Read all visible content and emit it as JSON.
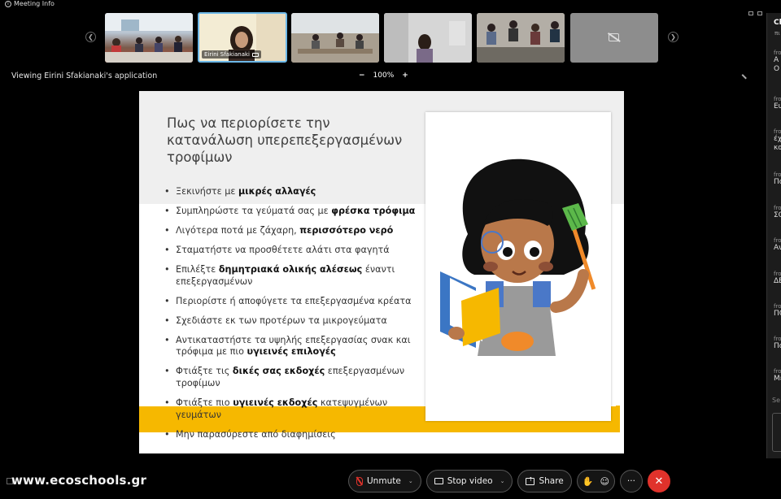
{
  "topbar": {
    "meeting_info": "Meeting Info"
  },
  "participants": [
    {
      "name": "",
      "active": false,
      "video": true
    },
    {
      "name": "Eirini Sfakianaki",
      "active": true,
      "video": true
    },
    {
      "name": "",
      "active": false,
      "video": true
    },
    {
      "name": "",
      "active": false,
      "video": true
    },
    {
      "name": "",
      "active": false,
      "video": true
    },
    {
      "name": "",
      "active": false,
      "video": false,
      "icon": "video-off-icon"
    }
  ],
  "viewbar": {
    "viewing": "Viewing Eirini Sfakianaki's application",
    "zoom_out": "−",
    "zoom_level": "100%",
    "zoom_in": "+"
  },
  "slide": {
    "title": "Πως να περιορίσετε την κατανάλωση υπερεπεξεργασμένων τροφίμων",
    "bullets": [
      {
        "text": "Ξεκινήστε με ",
        "bold": "μικρές αλλαγές",
        "rest": ""
      },
      {
        "text": "Συμπληρώστε τα γεύματά σας με ",
        "bold": "φρέσκα τρόφιμα",
        "rest": ""
      },
      {
        "text": "Λιγότερα ποτά με ζάχαρη, ",
        "bold": "περισσότερο νερό",
        "rest": ""
      },
      {
        "text": "Σταματήστε να προσθέτετε αλάτι στα φαγητά",
        "bold": "",
        "rest": ""
      },
      {
        "text": "Επιλέξτε ",
        "bold": "δημητριακά ολικής αλέσεως",
        "rest": " έναντι επεξεργασμένων"
      },
      {
        "text": "Περιορίστε ή αποφύγετε τα επεξεργασμένα κρέατα",
        "bold": "",
        "rest": ""
      },
      {
        "text": "Σχεδιάστε εκ των προτέρων τα μικρογεύματα",
        "bold": "",
        "rest": ""
      },
      {
        "text": "Αντικαταστήστε τα υψηλής επεξεργασίας σνακ και τρόφιμα με πιο ",
        "bold": "υγιεινές επιλογές",
        "rest": ""
      },
      {
        "text": "Φτιάξτε τις ",
        "bold": "δικές σας εκδοχές",
        "rest": " επεξεργασμένων τροφίμων"
      },
      {
        "text": "Φτιάξτε πιο ",
        "bold": "υγιεινές εκδοχές",
        "rest": " κατεψυγμένων γευμάτων"
      },
      {
        "text": "Μην παρασύρεστε από διαφημίσεις",
        "bold": "",
        "rest": ""
      }
    ],
    "colors": {
      "accent_yellow": "#f6b800",
      "band_gray": "#efefef"
    }
  },
  "logo": "www.ecoschools.gr",
  "controls": {
    "unmute": "Unmute",
    "stop_video": "Stop video",
    "share": "Share",
    "more": "···",
    "end": "✕"
  },
  "chat": {
    "title": "Ch",
    "subtitle": "πι",
    "messages": [
      {
        "from": "fro",
        "text": "Α",
        "text2": "Ο"
      },
      {
        "from": "fro",
        "text": "Ευ",
        "text2": ""
      },
      {
        "from": "fro",
        "text": "έχ",
        "text2": "κα"
      },
      {
        "from": "fro",
        "text": "Πο",
        "text2": ""
      },
      {
        "from": "fro",
        "text": "ΣΟ",
        "text2": ""
      },
      {
        "from": "fro",
        "text": "Αν",
        "text2": ""
      },
      {
        "from": "fro",
        "text": "ΔΕ",
        "text2": ""
      },
      {
        "from": "fro",
        "text": "ΠΟ",
        "text2": ""
      },
      {
        "from": "fro",
        "text": "Πο",
        "text2": ""
      },
      {
        "from": "fro",
        "text": "Με",
        "text2": ""
      }
    ],
    "input_placeholder": "Se"
  }
}
